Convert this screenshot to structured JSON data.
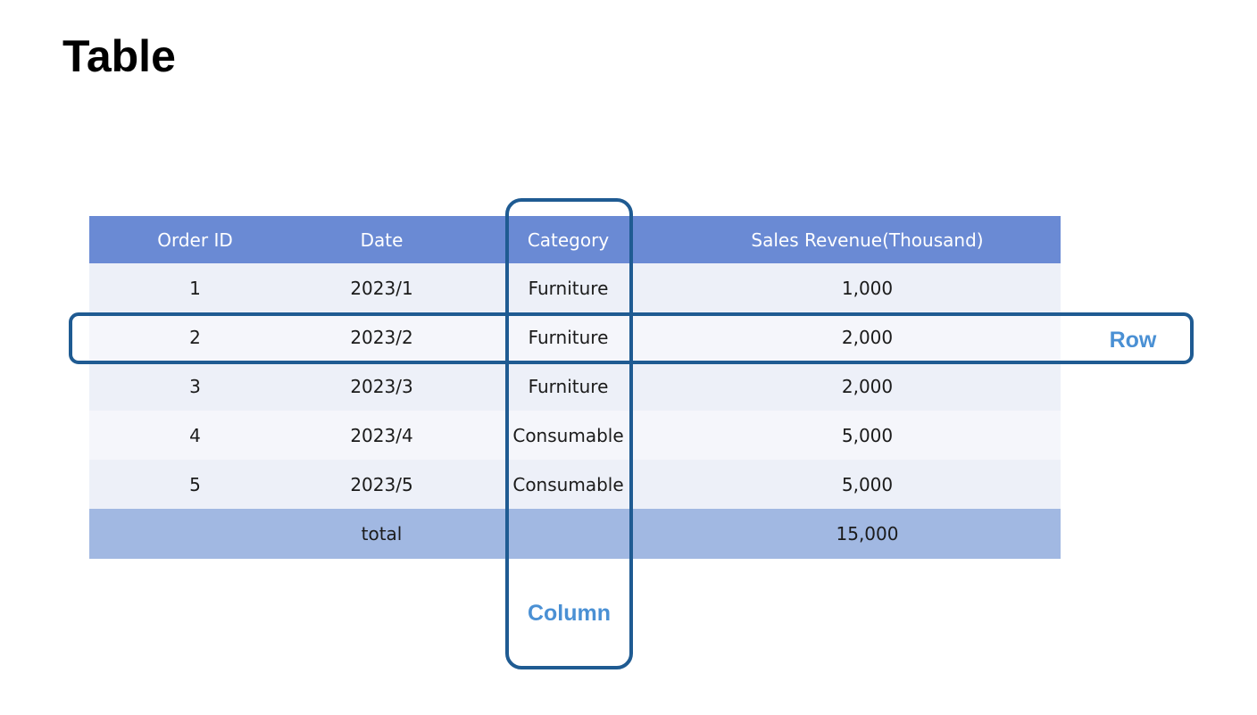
{
  "page": {
    "title": "Table"
  },
  "table": {
    "headers": [
      "Order ID",
      "Date",
      "Category",
      "Sales Revenue(Thousand)"
    ],
    "rows": [
      [
        "1",
        "2023/1",
        "Furniture",
        "1,000"
      ],
      [
        "2",
        "2023/2",
        "Furniture",
        "2,000"
      ],
      [
        "3",
        "2023/3",
        "Furniture",
        "2,000"
      ],
      [
        "4",
        "2023/4",
        "Consumable",
        "5,000"
      ],
      [
        "5",
        "2023/5",
        "Consumable",
        "5,000"
      ]
    ],
    "footer": {
      "label": "total",
      "total": "15,000"
    }
  },
  "annotations": {
    "row_label": "Row",
    "column_label": "Column"
  },
  "colors": {
    "header_bg": "#6a8ad4",
    "row_odd_bg": "#edf0f8",
    "row_even_bg": "#f5f6fb",
    "footer_bg": "#a1b8e2",
    "outline": "#1f5b92",
    "annotation_text": "#4a90d4"
  }
}
